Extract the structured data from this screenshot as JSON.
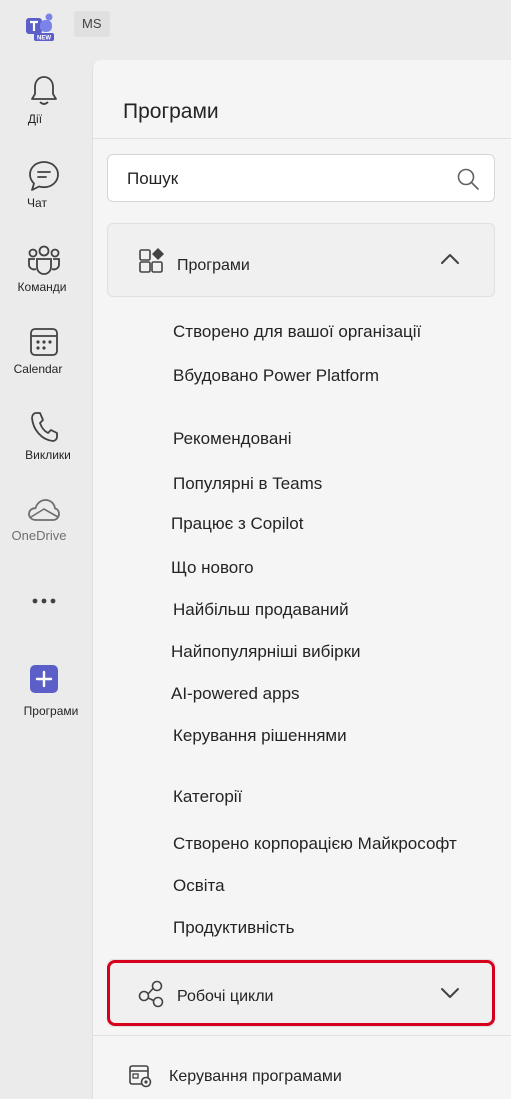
{
  "header": {
    "app_icon": "teams-new-logo",
    "app_badge": "NEW",
    "user_initials": "MS"
  },
  "rail": {
    "items": [
      {
        "label": "Дії",
        "icon": "bell-icon"
      },
      {
        "label": "Чат",
        "icon": "chat-icon"
      },
      {
        "label": "Команди",
        "icon": "teams-icon"
      },
      {
        "label": "Calendar",
        "icon": "calendar-icon"
      },
      {
        "label": "Виклики",
        "icon": "phone-icon"
      },
      {
        "label": "OneDrive",
        "icon": "cloud-icon"
      },
      {
        "label": "",
        "icon": "more-icon"
      },
      {
        "label": "Програми",
        "icon": "add-apps-icon"
      }
    ]
  },
  "panel": {
    "title": "Програми",
    "search": {
      "placeholder": "Пошук"
    },
    "apps_section": {
      "label": "Програми",
      "expanded": true
    },
    "items": [
      "Створено для вашої організації",
      "Вбудовано  Power Platform",
      "Рекомендовані",
      "Популярні в Teams",
      "Працює з Copilot",
      "Що нового",
      "Найбільш продаваний",
      "Найпопулярніші вибірки",
      "AI-powered apps",
      "Керування рішеннями",
      "Категорії",
      "Створено корпорацією Майкрософт",
      "Освіта",
      "Продуктивність"
    ],
    "workflows_section": {
      "label": "Робочі цикли",
      "expanded": false
    },
    "manage_label": "Керування програмами"
  },
  "colors": {
    "background": "#ebebeb",
    "panel": "#f5f5f5",
    "accent": "#5b5fc7",
    "highlight": "#d6001c"
  }
}
